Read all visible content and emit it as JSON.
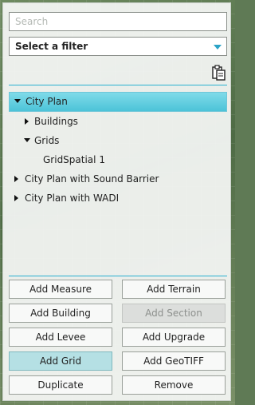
{
  "search": {
    "placeholder": "Search",
    "value": ""
  },
  "filter": {
    "selected": "Select a filter"
  },
  "toolbar": {
    "clipboard_icon": "clipboard-icon"
  },
  "tree": {
    "root": "City Plan",
    "buildings": "Buildings",
    "grids": "Grids",
    "grid_spatial": "GridSpatial 1",
    "sound_barrier": "City Plan with Sound Barrier",
    "wadi": "City Plan with WADI"
  },
  "buttons": {
    "add_measure": "Add Measure",
    "add_terrain": "Add Terrain",
    "add_building": "Add Building",
    "add_section": "Add Section",
    "add_levee": "Add Levee",
    "add_upgrade": "Add Upgrade",
    "add_grid": "Add Grid",
    "add_geotiff": "Add GeoTIFF",
    "duplicate": "Duplicate",
    "remove": "Remove"
  },
  "colors": {
    "accent": "#2ab0d0",
    "selected": "#4cc3d8",
    "active_button": "#b5e0e4"
  }
}
